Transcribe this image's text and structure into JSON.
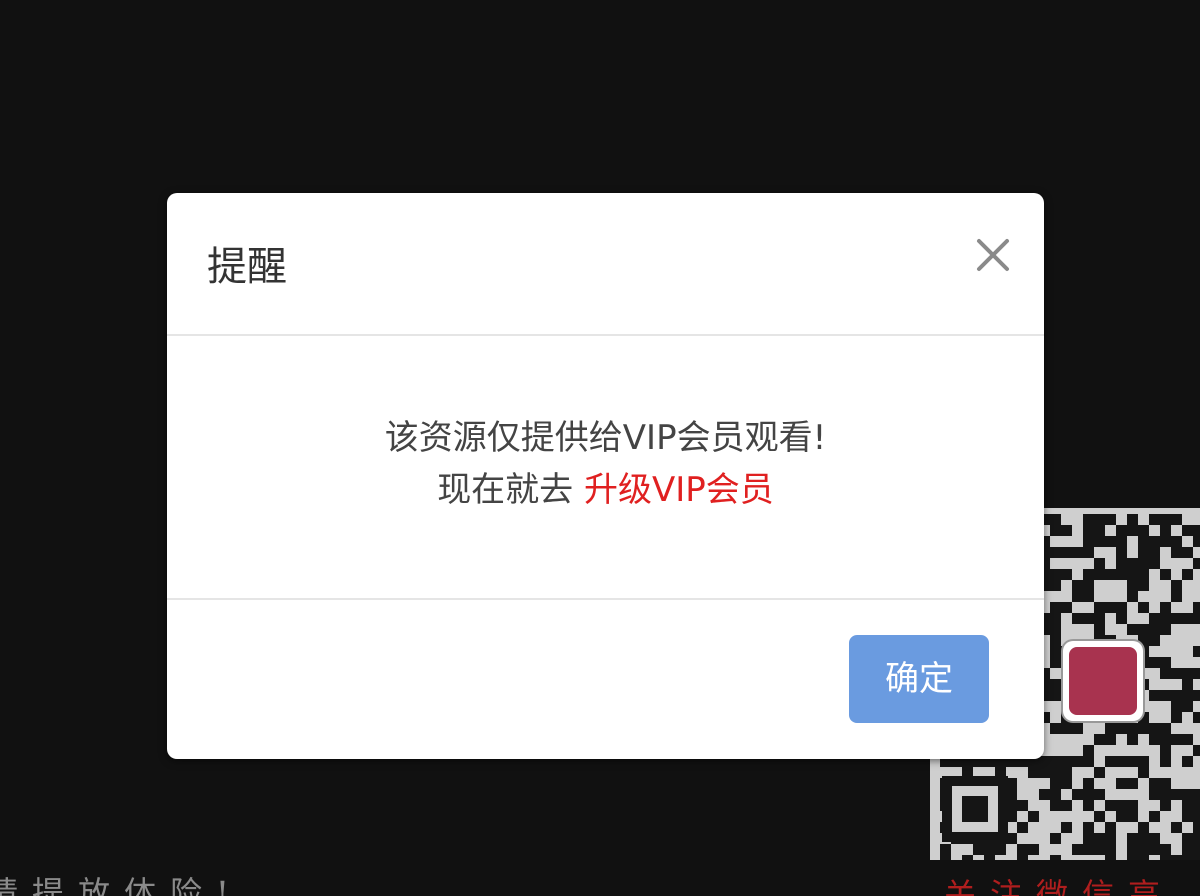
{
  "background": {
    "left_text": "请提放体险!",
    "right_text": "关注微信高"
  },
  "modal": {
    "title": "提醒",
    "close_icon": "close-icon",
    "message_line1": "该资源仅提供给VIP会员观看!",
    "message_line2_prefix": "现在就去 ",
    "upgrade_link": "升级VIP会员",
    "confirm_label": "确定"
  },
  "colors": {
    "backdrop": "#111111",
    "link": "#e02020",
    "button": "#6a9be0"
  }
}
